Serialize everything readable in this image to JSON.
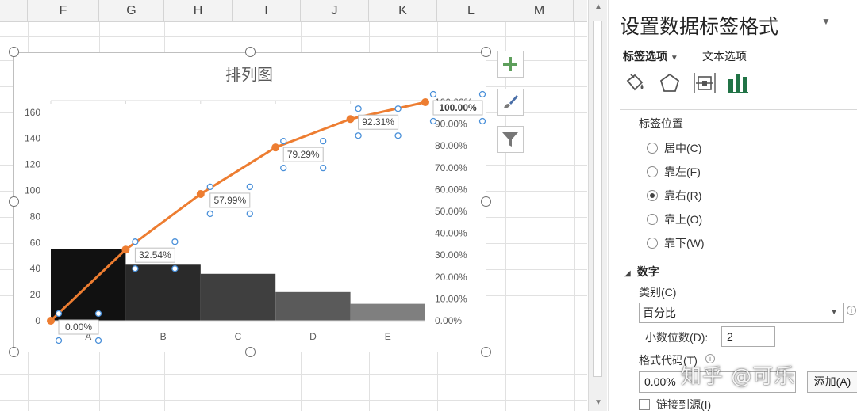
{
  "columns": [
    "F",
    "G",
    "H",
    "I",
    "J",
    "K",
    "L",
    "M"
  ],
  "chart_data": {
    "type": "bar",
    "title": "排列图",
    "categories": [
      "A",
      "B",
      "C",
      "D",
      "E"
    ],
    "values": [
      55,
      43,
      36,
      22,
      13
    ],
    "cumulative_percent": [
      0,
      32.54,
      57.99,
      79.29,
      92.31,
      100
    ],
    "cumulative_labels": [
      "0.00%",
      "32.54%",
      "57.99%",
      "79.29%",
      "92.31%",
      "100.00%"
    ],
    "y_ticks": [
      "0",
      "20",
      "40",
      "60",
      "80",
      "100",
      "120",
      "140",
      "160"
    ],
    "y2_ticks": [
      "0.00%",
      "10.00%",
      "20.00%",
      "30.00%",
      "40.00%",
      "50.00%",
      "60.00%",
      "70.00%",
      "80.00%",
      "90.00%",
      "100.00%"
    ],
    "ylim": [
      0,
      169
    ],
    "y2lim": [
      0,
      100
    ],
    "bar_colors": [
      "#111111",
      "#2a2a2a",
      "#3f3f3f",
      "#5a5a5a",
      "#7f7f7f"
    ],
    "line_color": "#ed7d31",
    "gridlines": true
  },
  "side_buttons": {
    "add_element": "plus-icon",
    "style": "brush-icon",
    "filter": "funnel-icon"
  },
  "pane": {
    "title": "设置数据标签格式",
    "tab_label_options": "标签选项",
    "tab_text_options": "文本选项",
    "label_position_title": "标签位置",
    "positions": [
      {
        "label": "居中(C)",
        "checked": false
      },
      {
        "label": "靠左(F)",
        "checked": false
      },
      {
        "label": "靠右(R)",
        "checked": true
      },
      {
        "label": "靠上(O)",
        "checked": false
      },
      {
        "label": "靠下(W)",
        "checked": false
      }
    ],
    "number_section": "数字",
    "category_label": "类别(C)",
    "category_value": "百分比",
    "decimals_label": "小数位数(D):",
    "decimals_value": "2",
    "format_code_label": "格式代码(T)",
    "format_code_value": "0.00%",
    "add_button": "添加(A)",
    "link_to_source": "链接到源(I)"
  },
  "watermark": "知乎 @可乐"
}
